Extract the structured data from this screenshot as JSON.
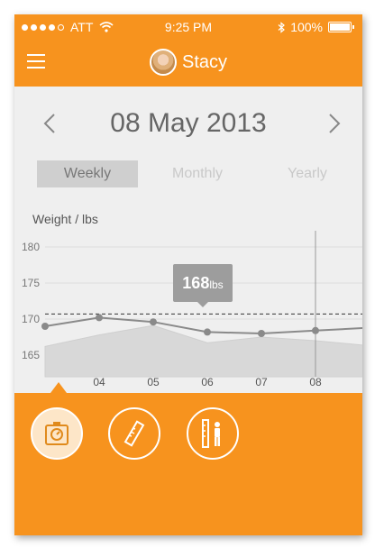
{
  "status": {
    "carrier": "ATT",
    "time": "9:25 PM",
    "battery": "100%"
  },
  "user": {
    "name": "Stacy"
  },
  "date": {
    "label": "08 May 2013"
  },
  "tabs": [
    {
      "label": "Weekly",
      "active": true
    },
    {
      "label": "Monthly",
      "active": false
    },
    {
      "label": "Yearly",
      "active": false
    }
  ],
  "tooltip": {
    "value": "168",
    "unit": "lbs"
  },
  "actions": [
    {
      "icon": "scale-icon",
      "active": true
    },
    {
      "icon": "ruler-icon",
      "active": false
    },
    {
      "icon": "height-measure-icon",
      "active": false
    }
  ],
  "colors": {
    "accent": "#f7931e",
    "chart_line": "#8a8a8a",
    "area": "#d8d8d8"
  },
  "chart_data": {
    "type": "line",
    "title": "Weight / lbs",
    "ylim": [
      162,
      181
    ],
    "yticks": [
      165,
      170,
      175,
      180
    ],
    "xticks": [
      "04",
      "05",
      "06",
      "07",
      "08"
    ],
    "target_line": 170.7,
    "series": [
      {
        "x": [
          "03",
          "04",
          "05",
          "06",
          "07",
          "08",
          "09"
        ],
        "values": [
          169,
          170.2,
          169.6,
          168.2,
          168,
          168.4,
          168.8
        ]
      },
      {
        "x": [
          "03",
          "04",
          "05",
          "06",
          "07",
          "08",
          "09"
        ],
        "values": [
          166.2,
          167.8,
          169.1,
          166.7,
          167.5,
          167.0,
          166.3
        ]
      }
    ]
  }
}
